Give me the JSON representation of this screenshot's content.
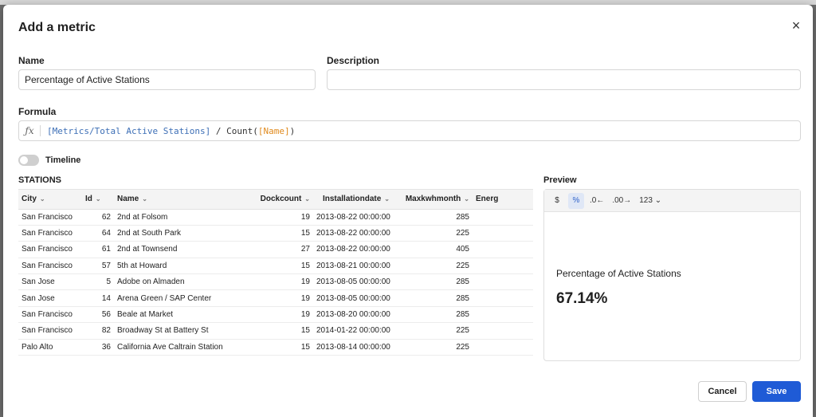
{
  "dialog": {
    "title": "Add a metric",
    "close_label": "×"
  },
  "fields": {
    "name_label": "Name",
    "name_value": "Percentage of Active Stations",
    "description_label": "Description",
    "description_value": "",
    "formula_label": "Formula",
    "formula_icon": "fx-icon",
    "formula_ref": "[Metrics/Total Active Stations]",
    "formula_mid": " / Count(",
    "formula_col": "[Name]",
    "formula_end": ")"
  },
  "timeline": {
    "label": "Timeline",
    "enabled": false
  },
  "table": {
    "title": "STATIONS",
    "columns": [
      "City",
      "Id",
      "Name",
      "Dockcount",
      "Installationdate",
      "Maxkwhmonth",
      "Energ"
    ],
    "rows": [
      [
        "San Francisco",
        "62",
        "2nd at Folsom",
        "19",
        "2013-08-22 00:00:00",
        "285"
      ],
      [
        "San Francisco",
        "64",
        "2nd at South Park",
        "15",
        "2013-08-22 00:00:00",
        "225"
      ],
      [
        "San Francisco",
        "61",
        "2nd at Townsend",
        "27",
        "2013-08-22 00:00:00",
        "405"
      ],
      [
        "San Francisco",
        "57",
        "5th at Howard",
        "15",
        "2013-08-21 00:00:00",
        "225"
      ],
      [
        "San Jose",
        "5",
        "Adobe on Almaden",
        "19",
        "2013-08-05 00:00:00",
        "285"
      ],
      [
        "San Jose",
        "14",
        "Arena Green / SAP Center",
        "19",
        "2013-08-05 00:00:00",
        "285"
      ],
      [
        "San Francisco",
        "56",
        "Beale at Market",
        "19",
        "2013-08-20 00:00:00",
        "285"
      ],
      [
        "San Francisco",
        "82",
        "Broadway St at Battery St",
        "15",
        "2014-01-22 00:00:00",
        "225"
      ],
      [
        "Palo Alto",
        "36",
        "California Ave Caltrain Station",
        "15",
        "2013-08-14 00:00:00",
        "225"
      ]
    ]
  },
  "preview": {
    "label": "Preview",
    "toolbar": [
      {
        "name": "currency-format-button",
        "text": "$"
      },
      {
        "name": "percent-format-button",
        "text": "%",
        "active": true
      },
      {
        "name": "decrease-decimals-button",
        "text": ".0←"
      },
      {
        "name": "increase-decimals-button",
        "text": ".00→"
      },
      {
        "name": "number-format-dropdown",
        "text": "123 ⌄"
      }
    ],
    "metric_name": "Percentage of Active Stations",
    "metric_value": "67.14%"
  },
  "buttons": {
    "cancel": "Cancel",
    "save": "Save"
  }
}
